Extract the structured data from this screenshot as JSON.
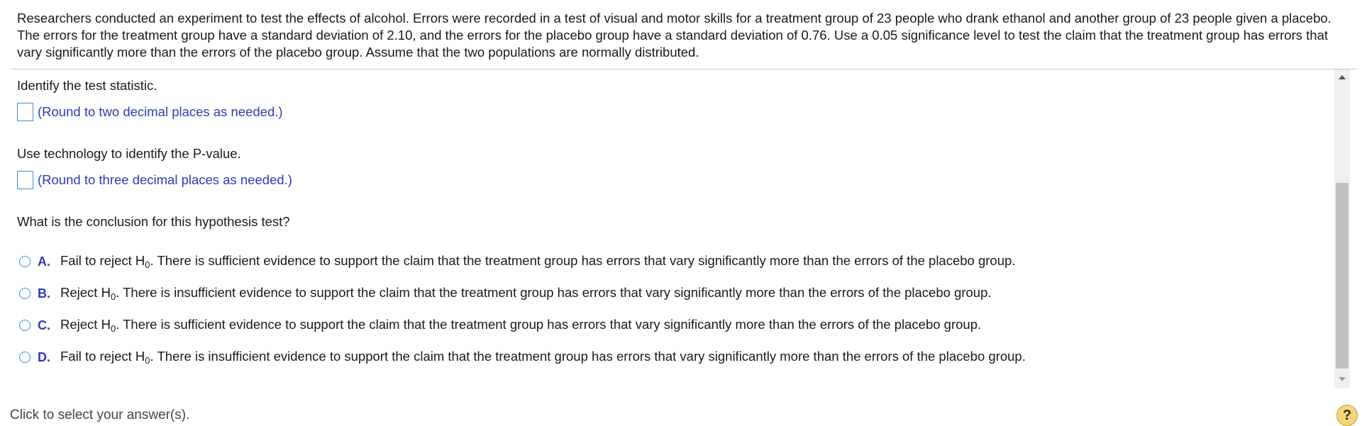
{
  "problem": {
    "text": "Researchers conducted an experiment to test the effects of alcohol. Errors were recorded in a test of visual and motor skills for a treatment group of 23 people who drank ethanol and another group of 23 people given a placebo. The errors for the treatment group have a standard deviation of 2.10, and the errors for the placebo group have a standard deviation of 0.76. Use a 0.05 significance level to test the claim that the treatment group has errors that vary significantly more than the errors of the placebo group. Assume that the two populations are normally distributed."
  },
  "questions": {
    "test_statistic": {
      "prompt": "Identify the test statistic.",
      "value": "",
      "hint": "(Round to two decimal places as needed.)"
    },
    "p_value": {
      "prompt": "Use technology to identify the P-value.",
      "value": "",
      "hint": "(Round to three decimal places as needed.)"
    },
    "conclusion": {
      "prompt": "What is the conclusion for this hypothesis test?",
      "options": [
        {
          "letter": "A.",
          "pre": "Fail to reject H",
          "sub": "0",
          "post": ". There is sufficient evidence to support the claim that the treatment group has errors that vary significantly more than the errors of the placebo group."
        },
        {
          "letter": "B.",
          "pre": "Reject H",
          "sub": "0",
          "post": ". There is insufficient evidence to support the claim that the treatment group has errors that vary significantly more than the errors of the placebo group."
        },
        {
          "letter": "C.",
          "pre": "Reject H",
          "sub": "0",
          "post": ". There is sufficient evidence to support the claim that the treatment group has errors that vary significantly more than the errors of the placebo group."
        },
        {
          "letter": "D.",
          "pre": "Fail to reject H",
          "sub": "0",
          "post": ". There is insufficient evidence to support the claim that the treatment group has errors that vary significantly more than the errors of the placebo group."
        }
      ]
    }
  },
  "footer": {
    "instruction": "Click to select your answer(s).",
    "help_label": "?"
  },
  "icons": {
    "help": "help-icon",
    "scroll_up": "scroll-up-arrow-icon",
    "scroll_down": "scroll-down-arrow-icon"
  },
  "colors": {
    "accent": "#2d3bb5",
    "input_border": "#3f8fd1",
    "help_bg": "#f4d77a"
  }
}
